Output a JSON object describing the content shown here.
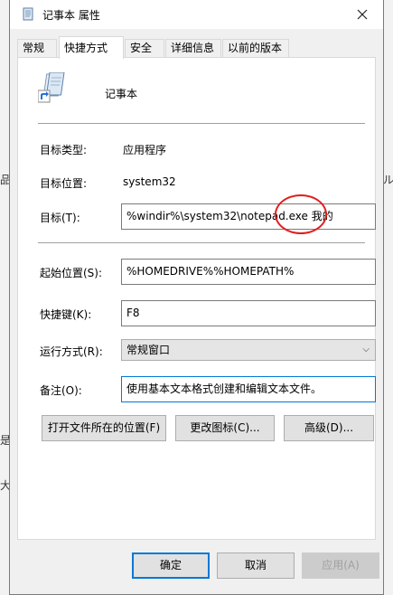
{
  "window": {
    "title": "记事本 属性",
    "close_icon": "close-icon"
  },
  "tabs": [
    {
      "label": "常规",
      "active": false
    },
    {
      "label": "快捷方式",
      "active": true
    },
    {
      "label": "安全",
      "active": false
    },
    {
      "label": "详细信息",
      "active": false
    },
    {
      "label": "以前的版本",
      "active": false
    }
  ],
  "shortcut": {
    "app_name": "记事本",
    "target_type_label": "目标类型:",
    "target_type_value": "应用程序",
    "target_location_label": "目标位置:",
    "target_location_value": "system32",
    "target_label": "目标(T):",
    "target_value": "%windir%\\system32\\notepad.exe 我的",
    "start_in_label": "起始位置(S):",
    "start_in_value": "%HOMEDRIVE%%HOMEPATH%",
    "shortcut_key_label": "快捷键(K):",
    "shortcut_key_value": "F8",
    "run_label": "运行方式(R):",
    "run_value": "常规窗口",
    "comment_label": "备注(O):",
    "comment_value": "使用基本文本格式创建和编辑文本文件。",
    "open_location_button": "打开文件所在的位置(F)",
    "change_icon_button": "更改图标(C)...",
    "advanced_button": "高级(D)..."
  },
  "footer": {
    "ok": "确定",
    "cancel": "取消",
    "apply": "应用(A)"
  },
  "background": {
    "glyphs": [
      "品",
      "是",
      "大",
      "ル"
    ]
  },
  "colors": {
    "accent": "#0078d7",
    "annotation": "#e02020"
  }
}
